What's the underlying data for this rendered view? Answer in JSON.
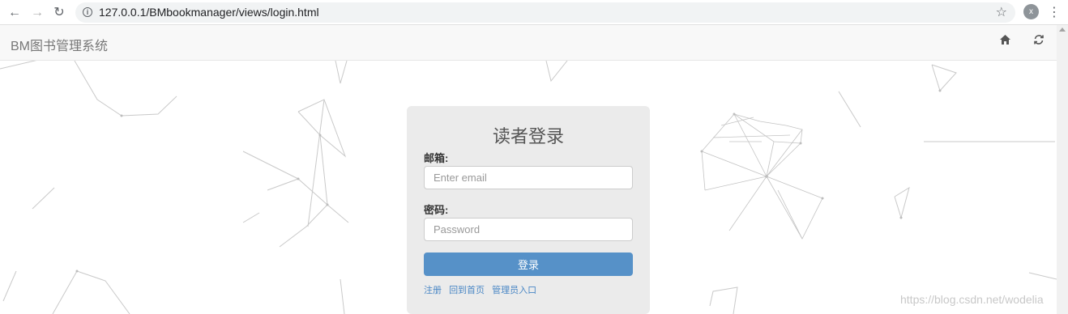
{
  "browser": {
    "url": "127.0.0.1/BMbookmanager/views/login.html",
    "profile_initial": "x"
  },
  "navbar": {
    "brand": "BM图书管理系统"
  },
  "login": {
    "title": "读者登录",
    "email_label": "邮箱:",
    "email_placeholder": "Enter email",
    "password_label": "密码:",
    "password_placeholder": "Password",
    "submit_label": "登录",
    "links": [
      "注册",
      "回到首页",
      "管理员入口"
    ]
  },
  "watermark": "https://blog.csdn.net/wodelia",
  "colors": {
    "primary_button": "#5691c8",
    "link": "#4a87c5",
    "panel_bg": "#ebebeb"
  }
}
